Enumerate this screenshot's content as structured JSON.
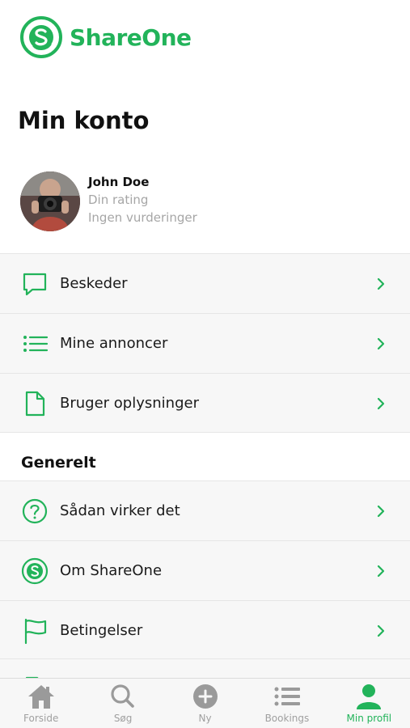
{
  "app": {
    "brand_name": "ShareOne",
    "brand_color": "#22b35a"
  },
  "page": {
    "title": "Min konto"
  },
  "profile": {
    "name": "John Doe",
    "rating_label": "Din rating",
    "reviews_label": "Ingen vurderinger"
  },
  "account_menu": [
    {
      "label": "Beskeder",
      "icon": "chat-bubble-icon"
    },
    {
      "label": "Mine annoncer",
      "icon": "list-icon"
    },
    {
      "label": "Bruger oplysninger",
      "icon": "document-icon"
    }
  ],
  "general": {
    "title": "Generelt",
    "items": [
      {
        "label": "Sådan virker det",
        "icon": "question-circle-icon"
      },
      {
        "label": "Om ShareOne",
        "icon": "shareone-logo-icon"
      },
      {
        "label": "Betingelser",
        "icon": "flag-icon"
      }
    ]
  },
  "tabbar": {
    "active_color": "#22b35a",
    "inactive_color": "#a0a0a0",
    "tabs": [
      {
        "label": "Forside",
        "icon": "home-icon",
        "active": false
      },
      {
        "label": "Søg",
        "icon": "search-icon",
        "active": false
      },
      {
        "label": "Ny",
        "icon": "plus-circle-icon",
        "active": false
      },
      {
        "label": "Bookings",
        "icon": "list-icon",
        "active": false
      },
      {
        "label": "Min profil",
        "icon": "person-icon",
        "active": true
      }
    ]
  }
}
